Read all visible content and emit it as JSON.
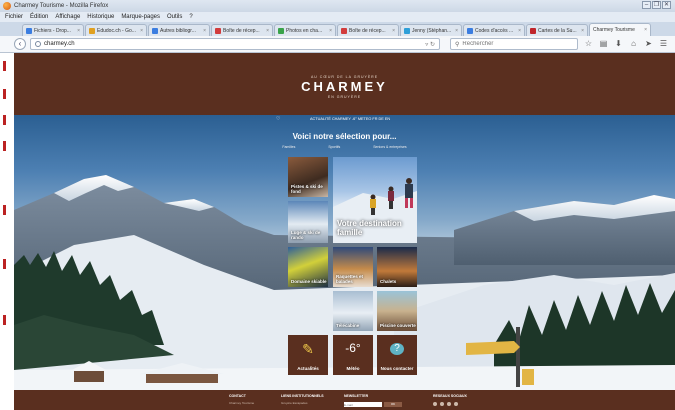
{
  "window": {
    "title": "Charmey Tourisme - Mozilla Firefox",
    "controls": [
      "–",
      "❐",
      "✕"
    ]
  },
  "menu": [
    "Fichier",
    "Édition",
    "Affichage",
    "Historique",
    "Marque-pages",
    "Outils",
    "?"
  ],
  "tabs": [
    {
      "label": "Fichiers - Drop...",
      "color": "#3b7de0"
    },
    {
      "label": "Edudoc.ch - Go...",
      "color": "#e0a020"
    },
    {
      "label": "Autres bibliogr...",
      "color": "#3b7de0"
    },
    {
      "label": "Boîte de récep...",
      "color": "#d23c3c"
    },
    {
      "label": "Photos en cha...",
      "color": "#3aa34a"
    },
    {
      "label": "Boîte de récep...",
      "color": "#d23c3c"
    },
    {
      "label": "Jenny (Stéphan...",
      "color": "#2e9fd8"
    },
    {
      "label": "Codes d'accès ...",
      "color": "#3b7de0"
    },
    {
      "label": "Cartes de la Su...",
      "color": "#c0262b"
    },
    {
      "label": "Charmey Tourisme",
      "color": "#ffffff",
      "active": true
    }
  ],
  "nav": {
    "url": "charmey.ch",
    "search_placeholder": "Rechercher"
  },
  "site": {
    "logo_top": "AU CŒUR DE LA GRUYÈRE",
    "logo": "CHARMEY",
    "logo_sub": "EN GRUYÈRE",
    "meteo": "ACTUALITÉ CHARMEY  -6° METEO  FR  DE  EN",
    "selection_title": "Voici notre sélection pour...",
    "filters": [
      "Familles",
      "Sportifs",
      "Seniors & entreprises"
    ],
    "tiles": [
      {
        "label": "Pistes & ski de fond"
      },
      {
        "label": "Votre destination famille"
      },
      {
        "label": "Luge & ski de rando"
      },
      {
        "label": "Domaine skiable"
      },
      {
        "label": "Raquettes et balades"
      },
      {
        "label": "Chalets"
      },
      {
        "label": "Télécabine"
      },
      {
        "label": "Piscine couverte"
      }
    ],
    "info_tiles": [
      {
        "label": "Actualités",
        "icon": "✎"
      },
      {
        "label": "Météo",
        "icon": "-6°"
      },
      {
        "label": "Nous contacter",
        "icon": "?"
      }
    ],
    "footer": [
      {
        "heading": "CONTACT",
        "line": "Charmey Tourisme"
      },
      {
        "heading": "LIENS INSTITUTIONNELS",
        "line": "Gruyère Escapades"
      },
      {
        "heading": "NEWSLETTER",
        "line": ""
      },
      {
        "heading": "RESEAUX SOCIAUX",
        "line": ""
      }
    ],
    "newsletter_placeholder": "E-mail",
    "newsletter_button": "OK"
  }
}
